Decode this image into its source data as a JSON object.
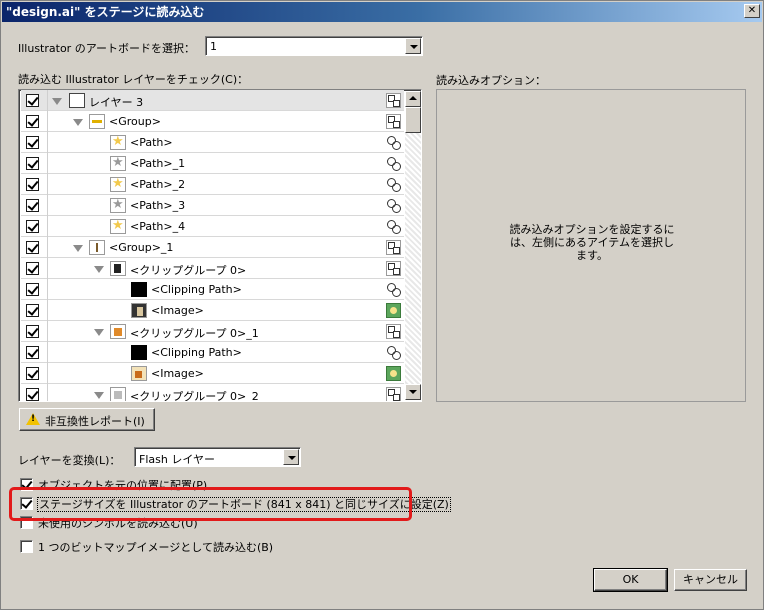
{
  "window": {
    "title": "\"design.ai\" をステージに読み込む"
  },
  "artboard": {
    "label": "Illustrator のアートボードを選択：",
    "value": "1"
  },
  "layers": {
    "label": "読み込む Illustrator レイヤーをチェック(C)：",
    "rows": [
      {
        "label": "レイヤー 3",
        "thumb": "layer"
      },
      {
        "label": "<Group>",
        "thumb": "group"
      },
      {
        "label": "<Path>",
        "thumb": "star-gold"
      },
      {
        "label": "<Path>_1",
        "thumb": "star-gray"
      },
      {
        "label": "<Path>_2",
        "thumb": "star-gold"
      },
      {
        "label": "<Path>_3",
        "thumb": "star-gray"
      },
      {
        "label": "<Path>_4",
        "thumb": "star-gold"
      },
      {
        "label": "<Group>_1",
        "thumb": "group"
      },
      {
        "label": "<クリップグループ 0>",
        "thumb": "clip"
      },
      {
        "label": "<Clipping Path>",
        "thumb": "black"
      },
      {
        "label": "<Image>",
        "thumb": "image"
      },
      {
        "label": "<クリップグループ 0>_1",
        "thumb": "clip"
      },
      {
        "label": "<Clipping Path>",
        "thumb": "black"
      },
      {
        "label": "<Image>",
        "thumb": "image"
      },
      {
        "label": "<クリップグループ 0>_2",
        "thumb": "clip"
      }
    ]
  },
  "options": {
    "label": "読み込みオプション：",
    "message": "読み込みオプションを設定するには、左側にあるアイテムを選択します。"
  },
  "incompat_button": "非互換性レポート(I)",
  "convert": {
    "label": "レイヤーを変換(L)：",
    "value": "Flash レイヤー"
  },
  "checkboxes": {
    "place_original": "オブジェクトを元の位置に配置(P)",
    "stage_size": "ステージサイズを Illustrator のアートボード (841 x 841) と同じサイズに設定(Z)",
    "unused_symbols": "未使用のシンボルを読み込む(U)",
    "single_bitmap": "1 つのビットマップイメージとして読み込む(B)"
  },
  "buttons": {
    "ok": "OK",
    "cancel": "キャンセル"
  },
  "colors": {
    "highlight": "#e21a1a",
    "titlebar": "#0a246a"
  }
}
